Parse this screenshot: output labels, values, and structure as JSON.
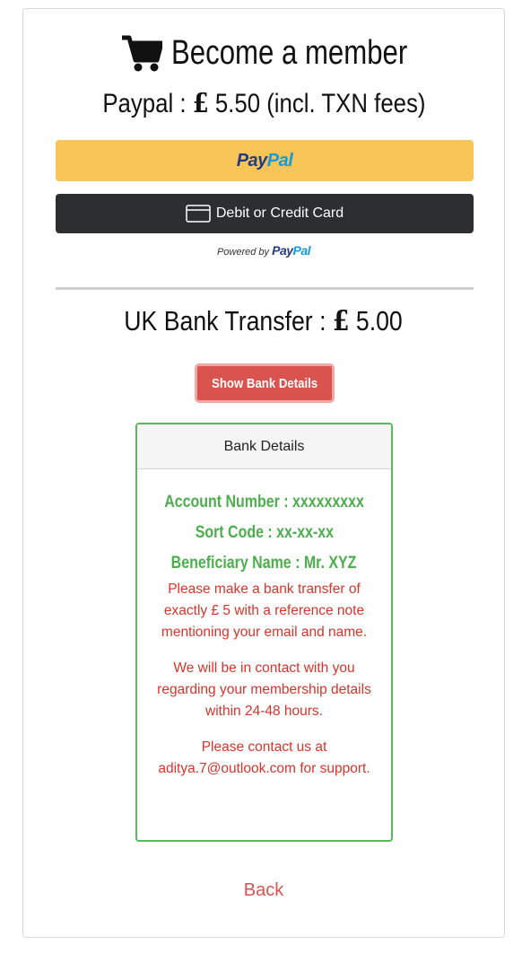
{
  "header": {
    "title": "Become a member",
    "cart_icon": "shopping-cart-icon",
    "paypal_price_label": "Paypal : ",
    "paypal_currency": "£",
    "paypal_amount": " 5.50 (incl. TXN fees)"
  },
  "paypal": {
    "button_pay": "Pay",
    "button_pal": "Pal",
    "card_button_label": "Debit or Credit Card",
    "card_icon": "credit-card-icon",
    "powered_by": "Powered by ",
    "powered_pay": "Pay",
    "powered_pal": "Pal",
    "colors": {
      "gold": "#f6c457",
      "dark": "#2c2e2f",
      "pay_blue": "#253b80",
      "pal_blue": "#179bd7"
    }
  },
  "bank": {
    "title_label": "UK Bank Transfer : ",
    "currency": "£",
    "amount": " 5.00",
    "show_button": "Show Bank Details",
    "panel_title": "Bank Details",
    "account_number": "Account Number : xxxxxxxxx",
    "sort_code": "Sort Code : xx-xx-xx",
    "beneficiary": "Beneficiary Name : Mr. XYZ",
    "instruction": "Please make a bank transfer of exactly £ 5 with a reference note mentioning your email and name.",
    "contact_note": "We will be in contact with you regarding your membership details within 24-48 hours.",
    "support_note": "Please contact us at aditya.7@outlook.com for support.",
    "colors": {
      "danger": "#d9534f",
      "success": "#5cb85c"
    }
  },
  "footer": {
    "back_link": "Back"
  }
}
